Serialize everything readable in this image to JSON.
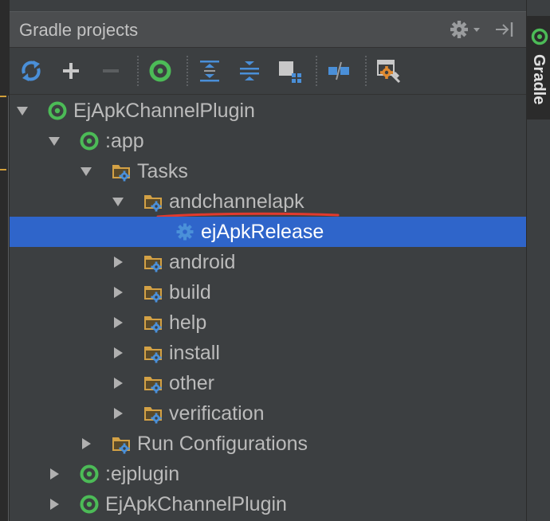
{
  "panel": {
    "title": "Gradle projects"
  },
  "side_tab": {
    "label": "Gradle"
  },
  "toolbar": {
    "buttons": [
      {
        "icon": "refresh-icon"
      },
      {
        "icon": "plus-icon"
      },
      {
        "icon": "minus-icon"
      },
      {
        "icon": "gradle-run-icon"
      },
      {
        "icon": "expand-all-icon"
      },
      {
        "icon": "collapse-all-icon"
      },
      {
        "icon": "group-modules-icon"
      },
      {
        "icon": "toggle-offline-icon"
      },
      {
        "icon": "gradle-settings-icon"
      }
    ]
  },
  "tree": {
    "rows": [
      {
        "label": "EjApkChannelPlugin",
        "level": 0,
        "expanded": true,
        "icon": "gradle-project-icon"
      },
      {
        "label": ":app",
        "level": 1,
        "expanded": true,
        "icon": "gradle-module-icon"
      },
      {
        "label": "Tasks",
        "level": 2,
        "expanded": true,
        "icon": "task-folder-icon"
      },
      {
        "label": "andchannelapk",
        "level": 3,
        "expanded": true,
        "icon": "task-folder-icon",
        "annotated": true
      },
      {
        "label": "ejApkRelease",
        "level": 4,
        "leaf": true,
        "icon": "gear-task-icon",
        "selected": true
      },
      {
        "label": "android",
        "level": 3,
        "expanded": false,
        "icon": "task-folder-icon"
      },
      {
        "label": "build",
        "level": 3,
        "expanded": false,
        "icon": "task-folder-icon"
      },
      {
        "label": "help",
        "level": 3,
        "expanded": false,
        "icon": "task-folder-icon"
      },
      {
        "label": "install",
        "level": 3,
        "expanded": false,
        "icon": "task-folder-icon"
      },
      {
        "label": "other",
        "level": 3,
        "expanded": false,
        "icon": "task-folder-icon"
      },
      {
        "label": "verification",
        "level": 3,
        "expanded": false,
        "icon": "task-folder-icon"
      },
      {
        "label": "Run Configurations",
        "level": 2,
        "expanded": false,
        "icon": "task-folder-icon"
      },
      {
        "label": ":ejplugin",
        "level": 1,
        "expanded": false,
        "icon": "gradle-module-icon"
      },
      {
        "label": "EjApkChannelPlugin",
        "level": 1,
        "expanded": false,
        "icon": "gradle-project-icon"
      }
    ]
  },
  "colors": {
    "background": "#3c3f41",
    "selection": "#2f65ca",
    "gradle_green": "#4cbb57",
    "folder": "#d3a145",
    "gear_blue": "#4a90d9",
    "annotation_red": "#e23a2e"
  }
}
